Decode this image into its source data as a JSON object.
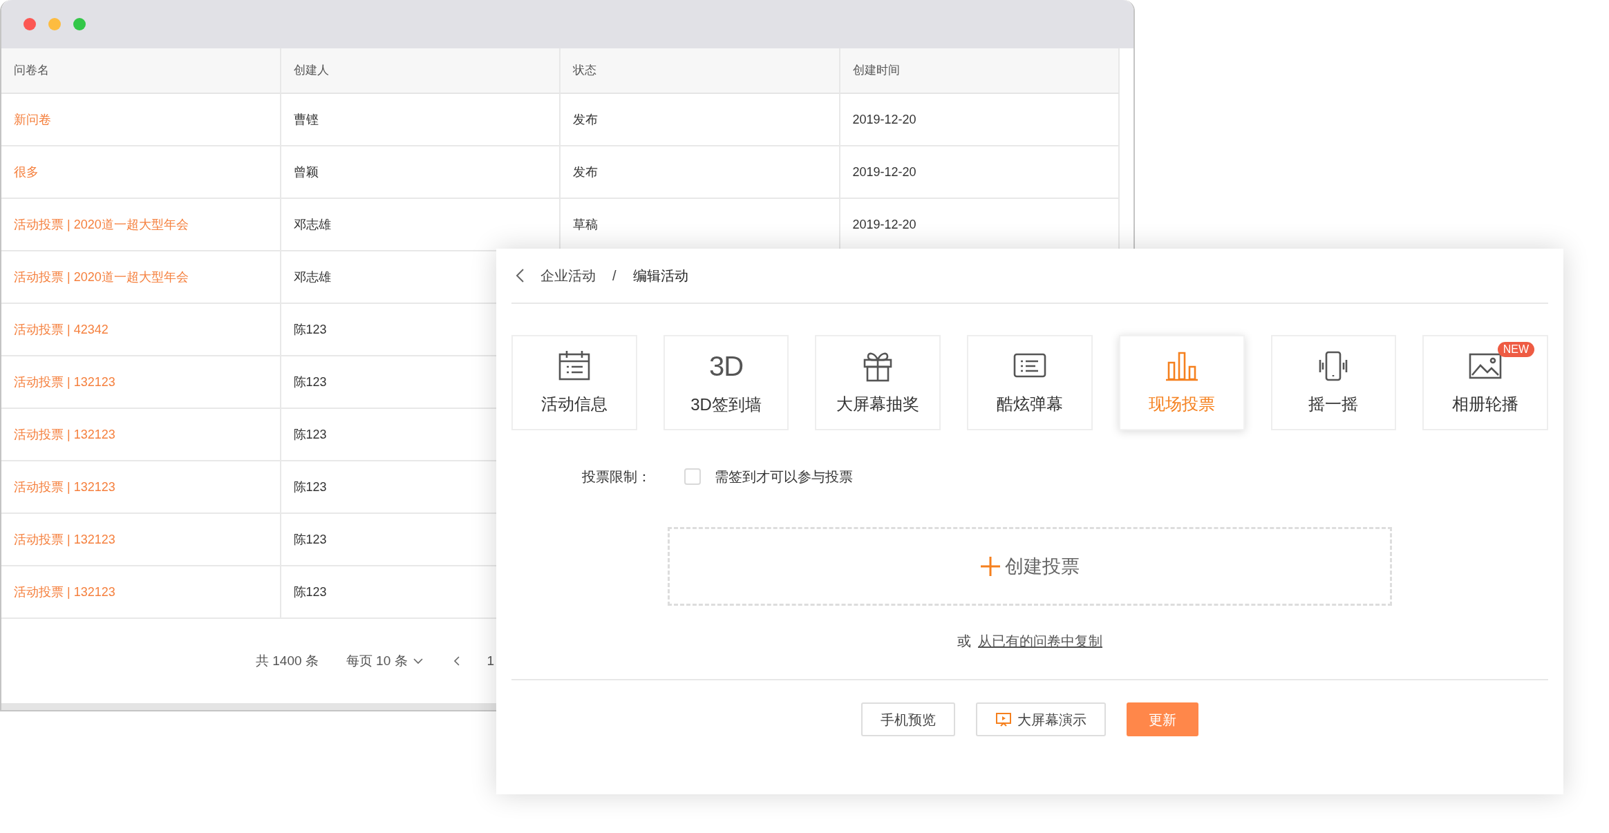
{
  "table": {
    "columns": [
      "问卷名",
      "创建人",
      "状态",
      "创建时间"
    ],
    "rows": [
      {
        "name": "新问卷",
        "creator": "曹铿",
        "status": "发布",
        "created": "2019-12-20"
      },
      {
        "name": "很多",
        "creator": "曾颖",
        "status": "发布",
        "created": "2019-12-20"
      },
      {
        "name": "活动投票 | 2020道一超大型年会",
        "creator": "邓志雄",
        "status": "草稿",
        "created": "2019-12-20"
      },
      {
        "name": "活动投票 | 2020道一超大型年会",
        "creator": "邓志雄"
      },
      {
        "name": "活动投票 | 42342",
        "creator": "陈123"
      },
      {
        "name": "活动投票 | 132123",
        "creator": "陈123"
      },
      {
        "name": "活动投票 | 132123",
        "creator": "陈123"
      },
      {
        "name": "活动投票 | 132123",
        "creator": "陈123"
      },
      {
        "name": "活动投票 | 132123",
        "creator": "陈123"
      },
      {
        "name": "活动投票 | 132123",
        "creator": "陈123"
      }
    ]
  },
  "pagination": {
    "total": "共 1400 条",
    "page_size": "每页 10 条",
    "page": "1"
  },
  "panel": {
    "breadcrumb": [
      "企业活动",
      "编辑活动"
    ],
    "separator": "/",
    "tiles": [
      {
        "label": "活动信息",
        "selected": false
      },
      {
        "label": "3D签到墙",
        "selected": false,
        "icon_text": "3D"
      },
      {
        "label": "大屏幕抽奖",
        "selected": false
      },
      {
        "label": "酷炫弹幕",
        "selected": false
      },
      {
        "label": "现场投票",
        "selected": true
      },
      {
        "label": "摇一摇",
        "selected": false
      },
      {
        "label": "相册轮播",
        "selected": false,
        "badge": "NEW"
      }
    ],
    "vote_limit": {
      "label": "投票限制：",
      "checkbox_label": "需签到才可以参与投票",
      "checked": false
    },
    "create_button": "创建投票",
    "copy": {
      "prefix": "或",
      "link": "从已有的问卷中复制"
    },
    "buttons": [
      {
        "label": "手机预览",
        "kind": "default"
      },
      {
        "label": "大屏幕演示",
        "kind": "screen"
      },
      {
        "label": "更新",
        "kind": "primary"
      }
    ]
  }
}
